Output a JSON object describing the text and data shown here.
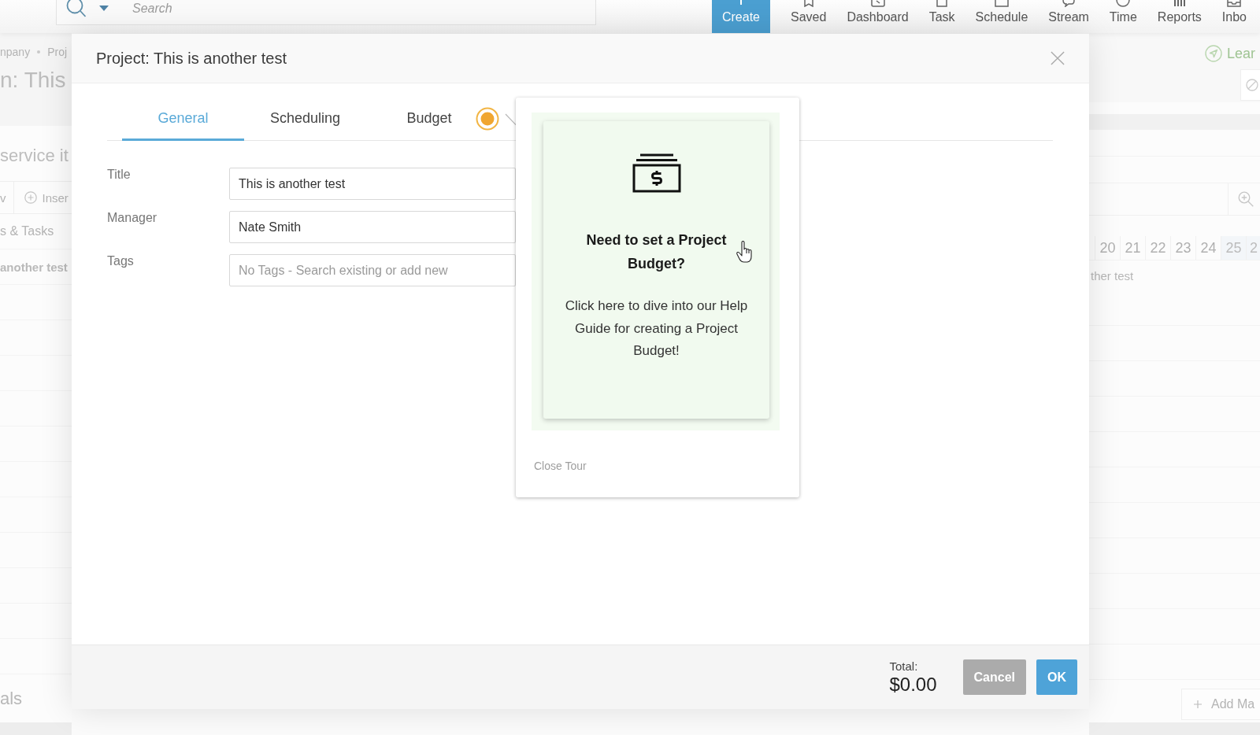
{
  "top_bar": {
    "search": {
      "placeholder": "Search"
    },
    "create_button": "Create",
    "nav": [
      "Saved",
      "Dashboard",
      "Task",
      "Schedule",
      "Stream",
      "Time",
      "Reports",
      "Inbo"
    ]
  },
  "background_page": {
    "left": {
      "breadcrumb": [
        "npany",
        "Proj"
      ],
      "heading": "n: This",
      "section_title": "service it",
      "toolbar": [
        "v",
        "Inser"
      ],
      "rows": [
        {
          "text": "s & Tasks",
          "kind": "group"
        },
        {
          "text": "another test",
          "kind": "project"
        }
      ],
      "bottom_heading": "als"
    },
    "right": {
      "link": "Lear",
      "dates": [
        {
          "label": "20",
          "weekend": false
        },
        {
          "label": "21",
          "weekend": false
        },
        {
          "label": "22",
          "weekend": false
        },
        {
          "label": "23",
          "weekend": false
        },
        {
          "label": "24",
          "weekend": false
        },
        {
          "label": "25",
          "weekend": true
        },
        {
          "label": "2",
          "weekend": true
        }
      ],
      "row_text": "ther test",
      "add_button": "Add Ma"
    }
  },
  "dialog": {
    "title": "Project: This is another test",
    "tabs": [
      {
        "label": "General",
        "selected": true
      },
      {
        "label": "Scheduling",
        "selected": false
      },
      {
        "label": "Budget",
        "selected": false
      }
    ],
    "fields": [
      {
        "label": "Title",
        "value": "This is another test"
      },
      {
        "label": "Manager",
        "value": "Nate Smith"
      },
      {
        "label": "Tags",
        "placeholder": "No Tags - Search existing or add new"
      }
    ],
    "footer": {
      "total_label": "Total:",
      "total": "$0.00",
      "buttons": [
        {
          "label": "Cancel",
          "kind": "secondary"
        },
        {
          "label": "OK",
          "kind": "primary"
        }
      ]
    }
  },
  "tour": {
    "heading": "Need to set a Project Budget?",
    "text": "Click here to dive into our Help Guide for creating a Project Budget!",
    "close": "Close Tour"
  }
}
